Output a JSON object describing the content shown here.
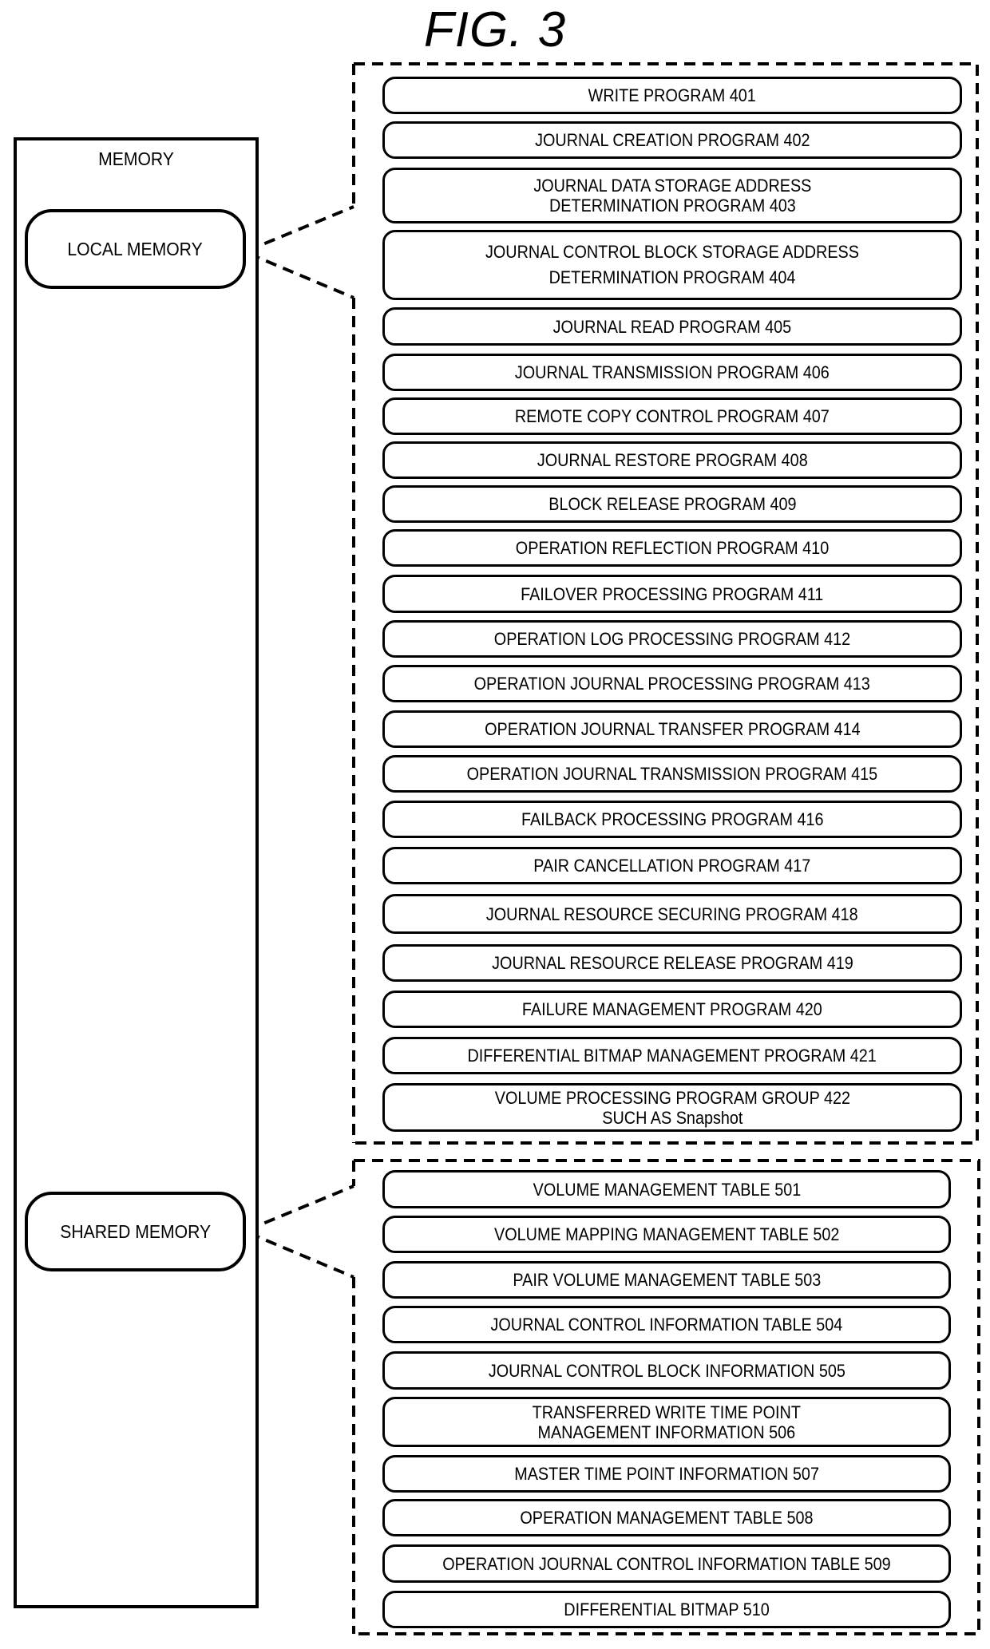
{
  "figure": {
    "title": "FIG. 3"
  },
  "memory": {
    "label": "MEMORY",
    "regions": [
      {
        "label": "LOCAL MEMORY",
        "expands_to": "local_memory_contents"
      },
      {
        "label": "SHARED MEMORY",
        "expands_to": "shared_memory_contents"
      }
    ]
  },
  "local_memory_contents": {
    "items": [
      {
        "label": "WRITE PROGRAM 401",
        "ref": "401"
      },
      {
        "label": "JOURNAL CREATION PROGRAM 402",
        "ref": "402"
      },
      {
        "label": "JOURNAL DATA STORAGE ADDRESS\nDETERMINATION PROGRAM 403",
        "ref": "403"
      },
      {
        "label": "JOURNAL CONTROL BLOCK STORAGE ADDRESS\nDETERMINATION PROGRAM 404",
        "ref": "404"
      },
      {
        "label": "JOURNAL READ PROGRAM 405",
        "ref": "405"
      },
      {
        "label": "JOURNAL TRANSMISSION PROGRAM 406",
        "ref": "406"
      },
      {
        "label": "REMOTE COPY CONTROL PROGRAM 407",
        "ref": "407"
      },
      {
        "label": "JOURNAL RESTORE PROGRAM 408",
        "ref": "408"
      },
      {
        "label": "BLOCK RELEASE PROGRAM 409",
        "ref": "409"
      },
      {
        "label": "OPERATION REFLECTION PROGRAM 410",
        "ref": "410"
      },
      {
        "label": "FAILOVER PROCESSING PROGRAM 411",
        "ref": "411"
      },
      {
        "label": "OPERATION LOG PROCESSING PROGRAM 412",
        "ref": "412"
      },
      {
        "label": "OPERATION JOURNAL PROCESSING PROGRAM 413",
        "ref": "413"
      },
      {
        "label": "OPERATION JOURNAL TRANSFER PROGRAM 414",
        "ref": "414"
      },
      {
        "label": "OPERATION JOURNAL TRANSMISSION PROGRAM 415",
        "ref": "415"
      },
      {
        "label": "FAILBACK PROCESSING PROGRAM 416",
        "ref": "416"
      },
      {
        "label": "PAIR CANCELLATION PROGRAM 417",
        "ref": "417"
      },
      {
        "label": "JOURNAL RESOURCE SECURING PROGRAM 418",
        "ref": "418"
      },
      {
        "label": "JOURNAL RESOURCE RELEASE PROGRAM 419",
        "ref": "419"
      },
      {
        "label": "FAILURE MANAGEMENT PROGRAM 420",
        "ref": "420"
      },
      {
        "label": "DIFFERENTIAL BITMAP MANAGEMENT PROGRAM 421",
        "ref": "421"
      },
      {
        "label": "VOLUME PROCESSING PROGRAM GROUP 422\nSUCH AS Snapshot",
        "ref": "422"
      }
    ]
  },
  "shared_memory_contents": {
    "items": [
      {
        "label": "VOLUME MANAGEMENT TABLE 501",
        "ref": "501"
      },
      {
        "label": "VOLUME MAPPING MANAGEMENT TABLE 502",
        "ref": "502"
      },
      {
        "label": "PAIR VOLUME MANAGEMENT TABLE 503",
        "ref": "503"
      },
      {
        "label": "JOURNAL CONTROL INFORMATION TABLE 504",
        "ref": "504"
      },
      {
        "label": "JOURNAL CONTROL BLOCK INFORMATION 505",
        "ref": "505"
      },
      {
        "label": "TRANSFERRED WRITE TIME POINT\nMANAGEMENT INFORMATION 506",
        "ref": "506"
      },
      {
        "label": "MASTER TIME POINT INFORMATION 507",
        "ref": "507"
      },
      {
        "label": "OPERATION MANAGEMENT TABLE 508",
        "ref": "508"
      },
      {
        "label": "OPERATION JOURNAL CONTROL INFORMATION TABLE 509",
        "ref": "509"
      },
      {
        "label": "DIFFERENTIAL BITMAP 510",
        "ref": "510"
      }
    ]
  }
}
